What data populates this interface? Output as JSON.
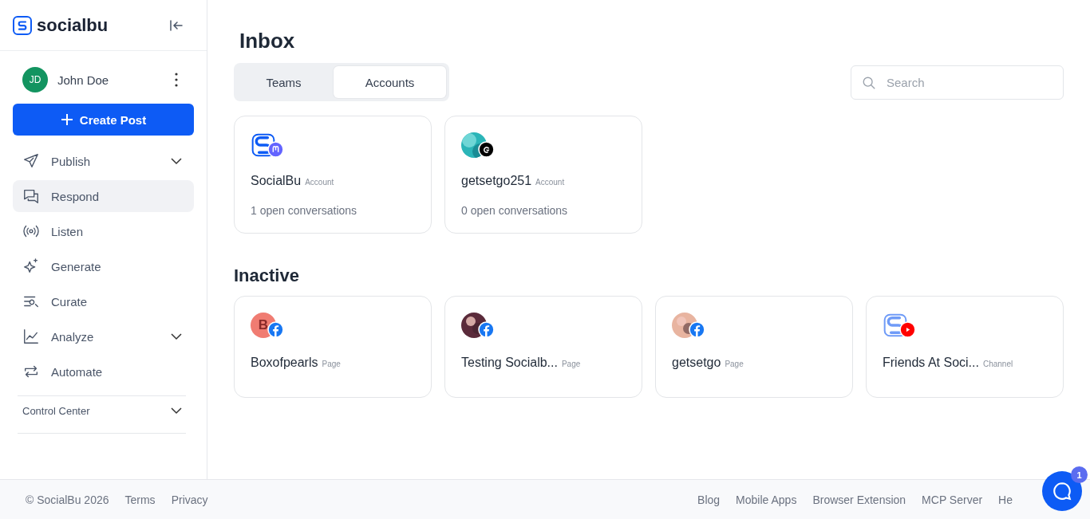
{
  "brand": {
    "name": "socialbu"
  },
  "user": {
    "initials": "JD",
    "name": "John Doe"
  },
  "create_button": {
    "label": "Create Post"
  },
  "nav": [
    {
      "label": "Publish",
      "expandable": true,
      "selected": false
    },
    {
      "label": "Respond",
      "expandable": false,
      "selected": true
    },
    {
      "label": "Listen",
      "expandable": false,
      "selected": false
    },
    {
      "label": "Generate",
      "expandable": false,
      "selected": false
    },
    {
      "label": "Curate",
      "expandable": false,
      "selected": false
    },
    {
      "label": "Analyze",
      "expandable": true,
      "selected": false
    },
    {
      "label": "Automate",
      "expandable": false,
      "selected": false
    }
  ],
  "control_center": {
    "label": "Control Center"
  },
  "title": "Inbox",
  "tabs": [
    {
      "label": "Teams",
      "selected": false
    },
    {
      "label": "Accounts",
      "selected": true
    }
  ],
  "search": {
    "placeholder": "Search"
  },
  "accounts": [
    {
      "name": "SocialBu",
      "type": "Account",
      "conversations": "1 open conversations"
    },
    {
      "name": "getsetgo251",
      "type": "Account",
      "conversations": "0 open conversations"
    }
  ],
  "inactive_title": "Inactive",
  "inactive": [
    {
      "name": "Boxofpearls",
      "type": "Page",
      "letter": "B"
    },
    {
      "name": "Testing Socialb...",
      "type": "Page"
    },
    {
      "name": "getsetgo",
      "type": "Page"
    },
    {
      "name": "Friends At Soci...",
      "type": "Channel"
    }
  ],
  "footer_left": [
    "© SocialBu 2026",
    "Terms",
    "Privacy"
  ],
  "footer_right": [
    "Blog",
    "Mobile Apps",
    "Browser Extension",
    "MCP Server",
    "He"
  ],
  "chat": {
    "badge": "1"
  }
}
